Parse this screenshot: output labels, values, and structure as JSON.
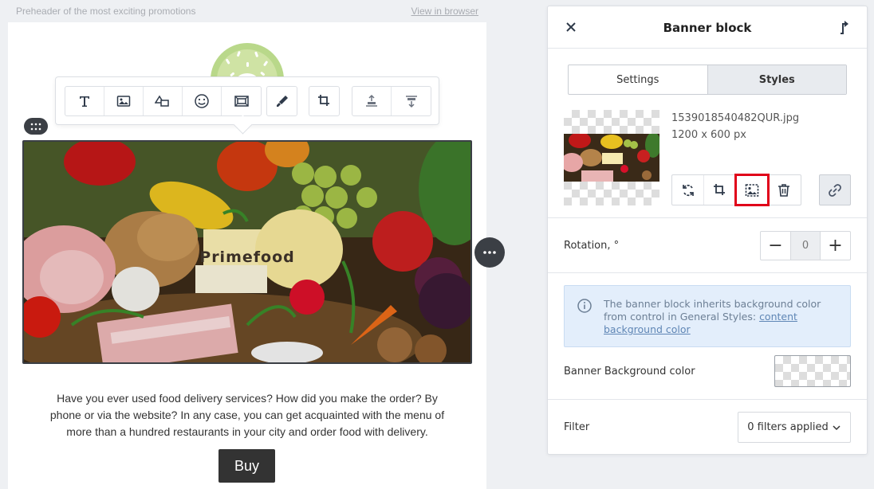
{
  "email": {
    "preheader": "Preheader of the most exciting promotions",
    "view_in_browser": "View in browser",
    "banner_text": "Primefood",
    "paragraph": "Have you ever used food delivery services? How did you make the order? By phone or via the website? In any case, you can get acquainted with the menu of more than a hundred restaurants in your city and order food with delivery.",
    "buy_button": "Buy"
  },
  "toolbar": {
    "icons": [
      "text-icon",
      "image-icon",
      "shapes-icon",
      "emoji-icon",
      "frame-icon",
      "paint-icon",
      "crop-icon",
      "align-top-icon",
      "align-bottom-icon"
    ]
  },
  "panel": {
    "title": "Banner block",
    "tabs": [
      "Settings",
      "Styles"
    ],
    "active_tab": "Styles",
    "file_name": "1539018540482QUR.jpg",
    "file_size": "1200 x 600 px",
    "rotation_label": "Rotation, °",
    "rotation_value": "0",
    "info_text": "The banner block inherits background color from control in General Styles: ",
    "info_link": "content background color",
    "bg_color_label": "Banner Background color",
    "filter_label": "Filter",
    "filter_value": "0 filters applied"
  },
  "colors": {
    "dark_ui": "#3b3f45",
    "highlight": "#e0001a",
    "info_bg": "#e3eefb"
  }
}
